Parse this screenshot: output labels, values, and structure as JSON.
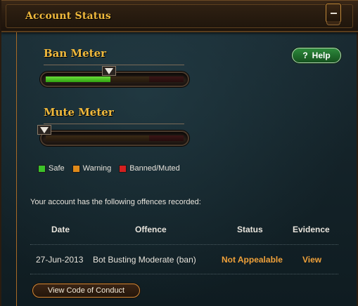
{
  "header": {
    "title": "Account Status",
    "collapse_icon": "minus-icon"
  },
  "help": {
    "label": "Help",
    "icon_glyph": "?"
  },
  "ban_meter": {
    "title": "Ban Meter",
    "level": 0.47
  },
  "mute_meter": {
    "title": "Mute Meter",
    "level": 0.0
  },
  "legend": [
    {
      "label": "Safe",
      "color": "#3cc22a"
    },
    {
      "label": "Warning",
      "color": "#e08a1a"
    },
    {
      "label": "Banned/Muted",
      "color": "#d42020"
    }
  ],
  "offences": {
    "intro": "Your account has the following offences recorded:",
    "columns": [
      "Date",
      "Offence",
      "Status",
      "Evidence"
    ],
    "rows": [
      {
        "date": "27-Jun-2013",
        "offence": "Bot Busting Moderate (ban)",
        "status": "Not Appealable",
        "evidence": "View"
      }
    ]
  },
  "conduct_button": {
    "label": "View Code of Conduct"
  },
  "colors": {
    "accent_gold": "#f0b93c",
    "status_orange": "#f0a13a",
    "help_green": "#2e8a3c"
  }
}
